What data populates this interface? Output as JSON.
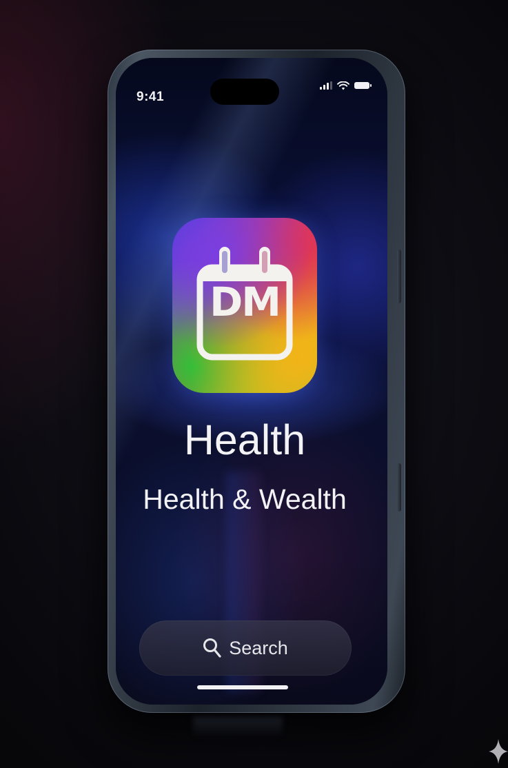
{
  "status_bar": {
    "time": "9:41",
    "icons": [
      "signal-icon",
      "wifi-icon",
      "battery-icon"
    ]
  },
  "app": {
    "icon_name": "calendar-icon",
    "icon_monogram": "DM",
    "title": "Health",
    "subtitle": "Health & Wealth"
  },
  "search": {
    "icon": "search-icon",
    "label": "Search"
  },
  "colors": {
    "background": "#07070b",
    "screen": "#0a1240",
    "text": "#f3f3f6",
    "search_bar": "#2f2f42"
  }
}
